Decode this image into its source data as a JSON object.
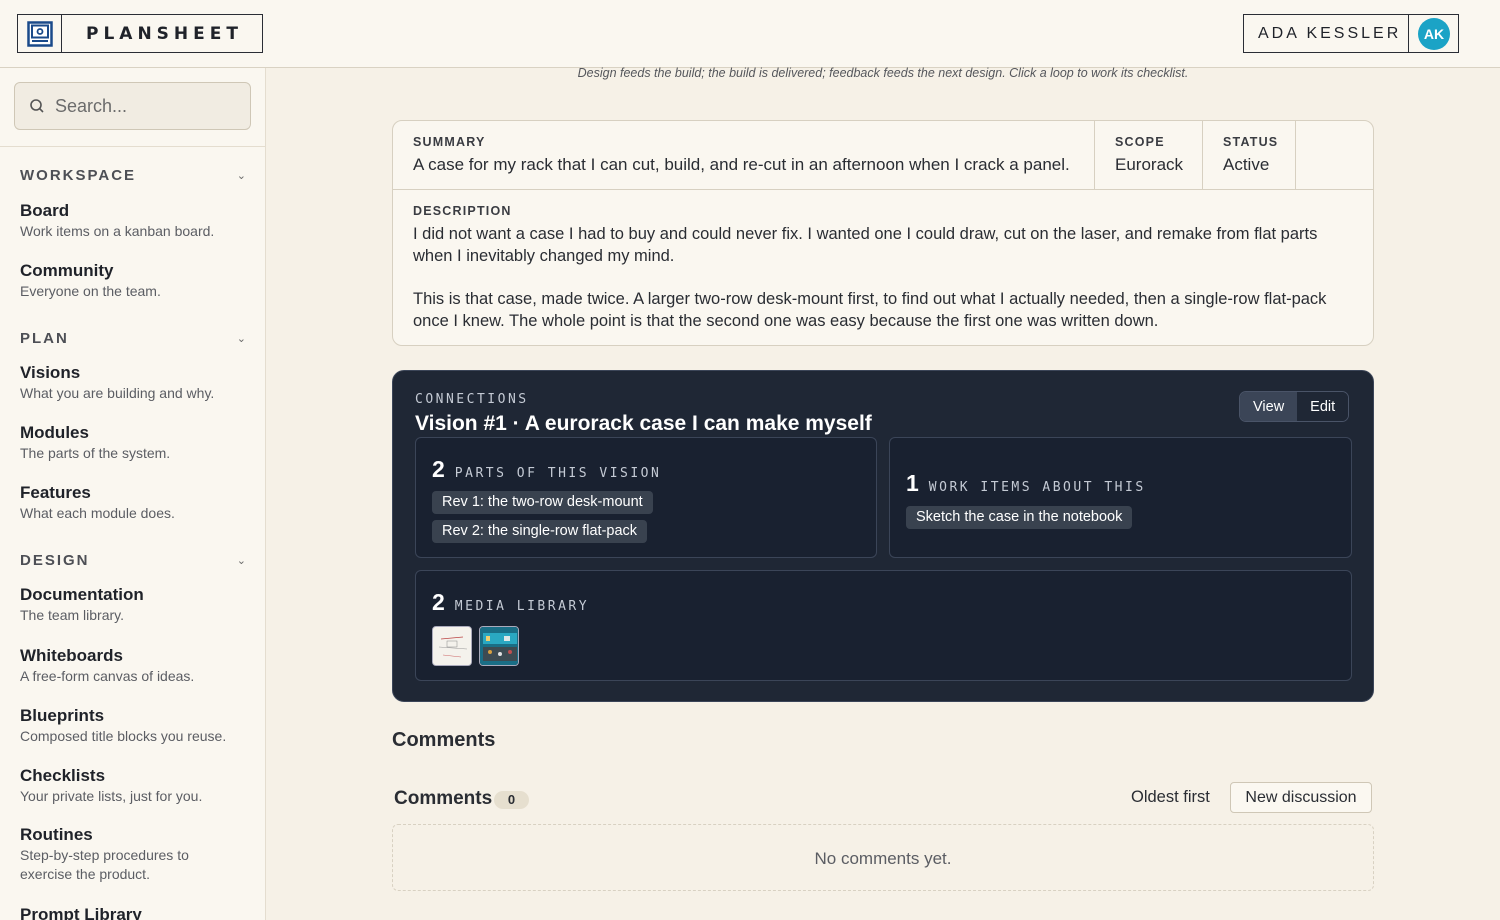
{
  "header": {
    "brand": "PLANSHEET",
    "user_name": "ADA KESSLER",
    "user_initials": "AK"
  },
  "sidebar": {
    "search_placeholder": "Search...",
    "groups": [
      {
        "title": "WORKSPACE",
        "items": [
          {
            "label": "Board",
            "desc": "Work items on a kanban board."
          },
          {
            "label": "Community",
            "desc": "Everyone on the team."
          }
        ]
      },
      {
        "title": "PLAN",
        "items": [
          {
            "label": "Visions",
            "desc": "What you are building and why."
          },
          {
            "label": "Modules",
            "desc": "The parts of the system."
          },
          {
            "label": "Features",
            "desc": "What each module does."
          }
        ]
      },
      {
        "title": "DESIGN",
        "items": [
          {
            "label": "Documentation",
            "desc": "The team library."
          },
          {
            "label": "Whiteboards",
            "desc": "A free-form canvas of ideas."
          },
          {
            "label": "Blueprints",
            "desc": "Composed title blocks you reuse."
          },
          {
            "label": "Checklists",
            "desc": "Your private lists, just for you."
          },
          {
            "label": "Routines",
            "desc": "Step-by-step procedures to exercise the product."
          },
          {
            "label": "Prompt Library",
            "desc": ""
          }
        ]
      }
    ]
  },
  "main": {
    "caption": "Design feeds the build; the build is delivered; feedback feeds the next design. Click a loop to work its checklist.",
    "summary_label": "SUMMARY",
    "summary": "A case for my rack that I can cut, build, and re-cut in an afternoon when I crack a panel.",
    "scope_label": "SCOPE",
    "scope": "Eurorack",
    "status_label": "STATUS",
    "status": "Active",
    "description_label": "DESCRIPTION",
    "description_p1": "I did not want a case I had to buy and could never fix. I wanted one I could draw, cut on the laser, and remake from flat parts when I inevitably changed my mind.",
    "description_p2": "This is that case, made twice. A larger two-row desk-mount first, to find out what I actually needed, then a single-row flat-pack once I knew. The whole point is that the second one was easy because the first one was written down."
  },
  "connections": {
    "label": "CONNECTIONS",
    "title": "Vision #1 · A eurorack case I can make myself",
    "view_label": "View",
    "edit_label": "Edit",
    "parts": {
      "count": "2",
      "label": "PARTS OF THIS VISION",
      "items": [
        "Rev 1: the two-row desk-mount",
        "Rev 2: the single-row flat-pack"
      ]
    },
    "work": {
      "count": "1",
      "label": "WORK ITEMS ABOUT THIS",
      "items": [
        "Sketch the case in the notebook"
      ]
    },
    "media": {
      "count": "2",
      "label": "MEDIA LIBRARY"
    }
  },
  "comments": {
    "heading": "Comments",
    "bar_title": "Comments",
    "count": "0",
    "sort_label": "Oldest first",
    "new_label": "New discussion",
    "empty": "No comments yet."
  },
  "colors": {
    "background": "#f6f1e7",
    "panel_dark": "#1f2735",
    "avatar": "#1ba3c6"
  }
}
